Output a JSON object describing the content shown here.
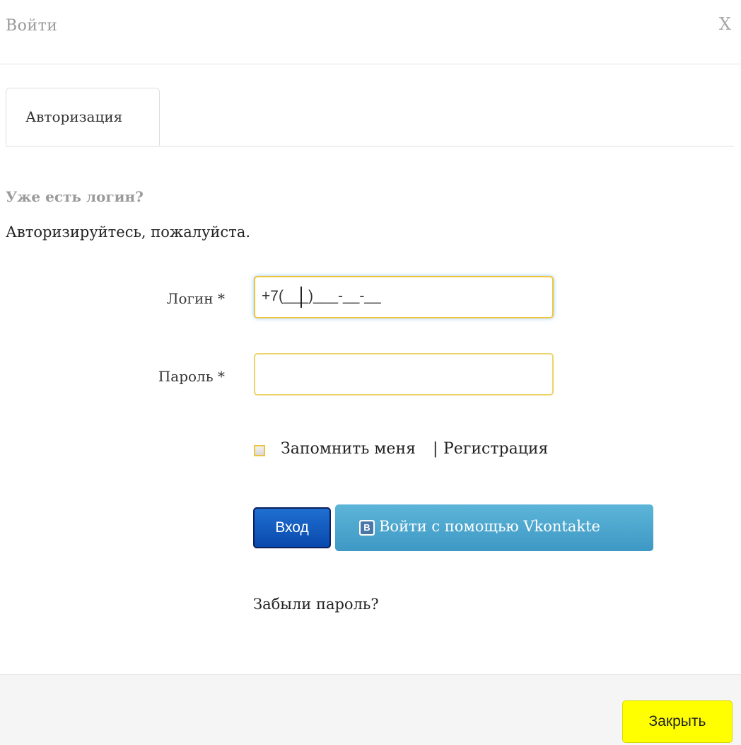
{
  "header": {
    "title": "Войти",
    "close_label": "X"
  },
  "tabs": [
    {
      "label": "Авторизация",
      "active": true
    }
  ],
  "intro": {
    "heading": "Уже есть логин?",
    "text": "Авторизируйтесь, пожалуйста."
  },
  "form": {
    "login_label": "Логин *",
    "login_value": "+7(___)___-__-__",
    "password_label": "Пароль *",
    "password_value": "",
    "remember_label": "Запомнить меня",
    "separator": "|",
    "register_link": "Регистрация",
    "remember_checked": false
  },
  "buttons": {
    "login": "Вход",
    "vk": "Войти с помощью Vkontakte",
    "vk_icon_letter": "В"
  },
  "links": {
    "forgot_password": "Забыли пароль?"
  },
  "footer": {
    "close_button": "Закрыть"
  },
  "colors": {
    "login_button": "#0a49ad",
    "vk_button": "#3d98c4",
    "close_button": "#ffff00",
    "input_border": "#ecd36a"
  },
  "icons": {
    "vk": "vk-icon",
    "close": "close-icon",
    "checkbox": "checkbox"
  }
}
